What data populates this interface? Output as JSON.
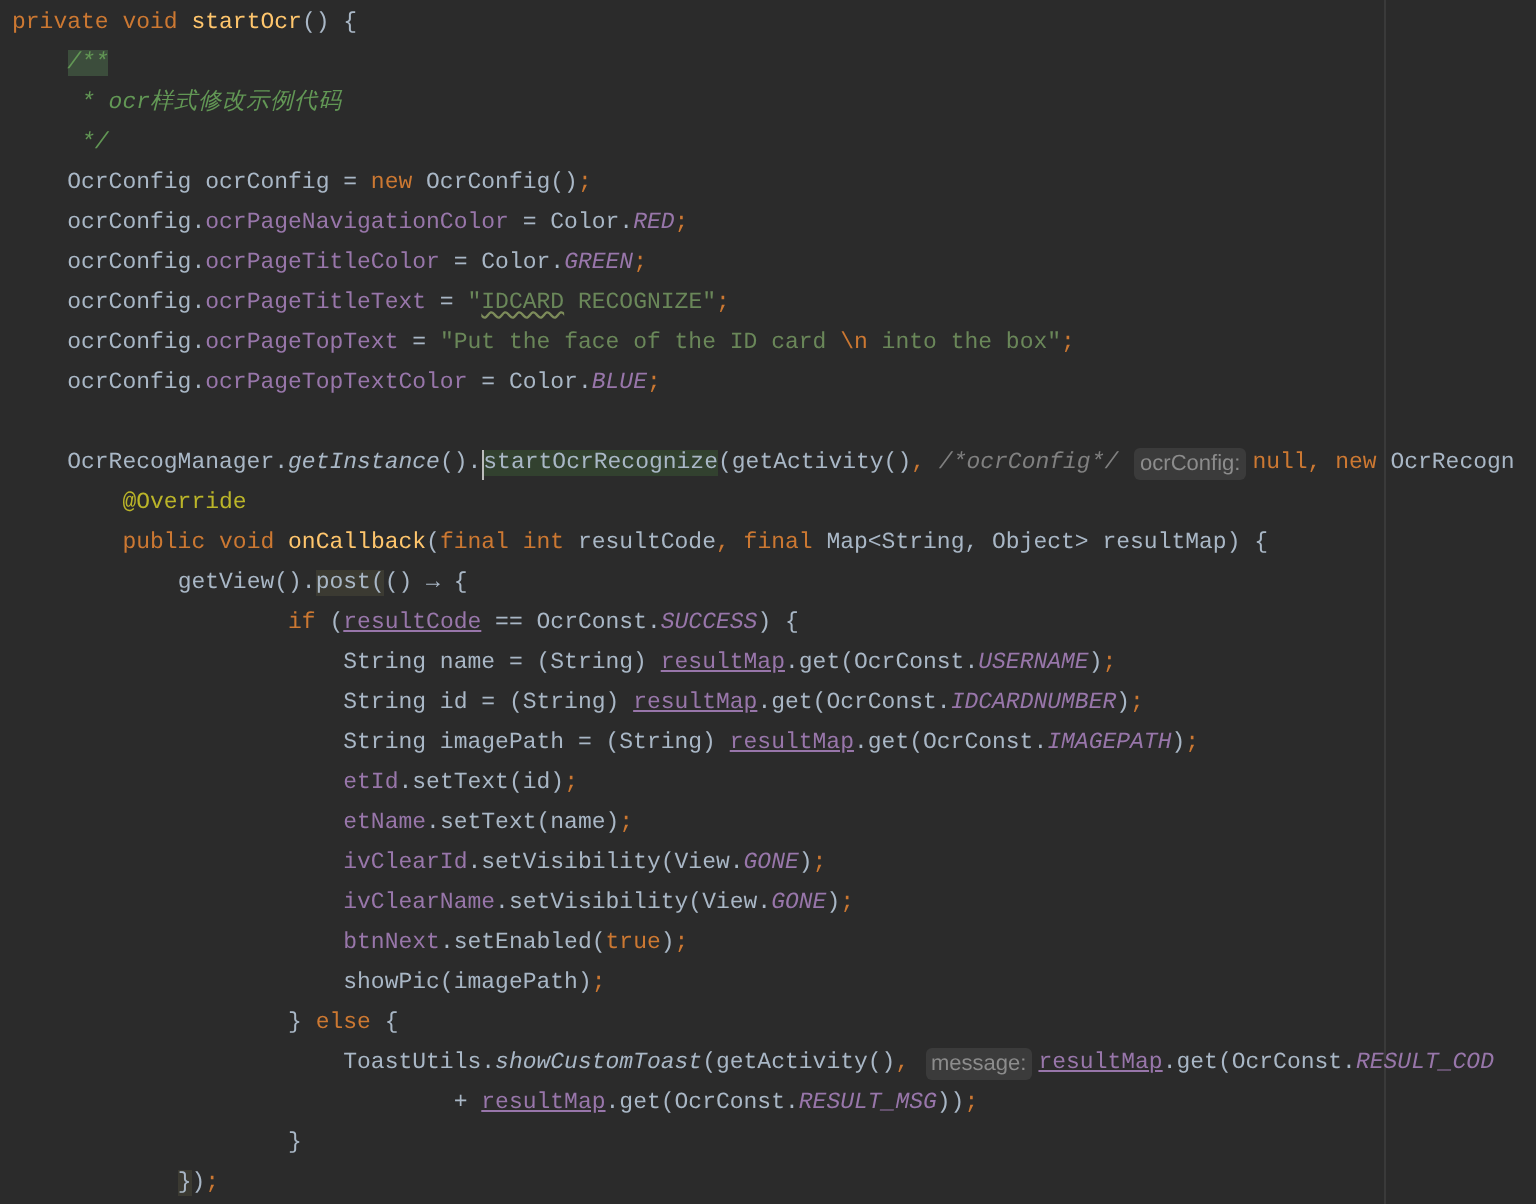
{
  "editor": {
    "lines": [
      {
        "tokens": [
          {
            "kind": "keyword",
            "text": "private void "
          },
          {
            "kind": "declaration",
            "text": "startOcr"
          },
          {
            "kind": "plain",
            "text": "() {"
          }
        ],
        "children": [
          {
            "tokens": [
              {
                "kind": "docmark",
                "text": "/**"
              }
            ]
          },
          {
            "tokens": [
              {
                "kind": "doc",
                "text": " * ocr样式修改示例代码"
              }
            ]
          },
          {
            "tokens": [
              {
                "kind": "doc",
                "text": " */"
              }
            ]
          },
          {
            "tokens": [
              {
                "kind": "plain",
                "text": "OcrConfig ocrConfig = "
              },
              {
                "kind": "keyword",
                "text": "new "
              },
              {
                "kind": "plain",
                "text": "OcrConfig()"
              },
              {
                "kind": "keyword",
                "text": ";"
              }
            ]
          },
          {
            "tokens": [
              {
                "kind": "plain",
                "text": "ocrConfig."
              },
              {
                "kind": "field",
                "text": "ocrPageNavigationColor"
              },
              {
                "kind": "plain",
                "text": " = Color."
              },
              {
                "kind": "static",
                "text": "RED"
              },
              {
                "kind": "keyword",
                "text": ";"
              }
            ]
          },
          {
            "tokens": [
              {
                "kind": "plain",
                "text": "ocrConfig."
              },
              {
                "kind": "field",
                "text": "ocrPageTitleColor"
              },
              {
                "kind": "plain",
                "text": " = Color."
              },
              {
                "kind": "static",
                "text": "GREEN"
              },
              {
                "kind": "keyword",
                "text": ";"
              }
            ]
          },
          {
            "tokens": [
              {
                "kind": "plain",
                "text": "ocrConfig."
              },
              {
                "kind": "field",
                "text": "ocrPageTitleText"
              },
              {
                "kind": "plain",
                "text": " = "
              },
              {
                "kind": "string",
                "text": "\""
              },
              {
                "kind": "typo",
                "text": "IDCARD"
              },
              {
                "kind": "string",
                "text": " RECOGNIZE\""
              },
              {
                "kind": "keyword",
                "text": ";"
              }
            ]
          },
          {
            "tokens": [
              {
                "kind": "plain",
                "text": "ocrConfig."
              },
              {
                "kind": "field",
                "text": "ocrPageTopText"
              },
              {
                "kind": "plain",
                "text": " = "
              },
              {
                "kind": "string",
                "text": "\"Put the face of the ID card "
              },
              {
                "kind": "keyword",
                "text": "\\n"
              },
              {
                "kind": "string",
                "text": " into the box\""
              },
              {
                "kind": "keyword",
                "text": ";"
              }
            ]
          },
          {
            "tokens": [
              {
                "kind": "plain",
                "text": "ocrConfig."
              },
              {
                "kind": "field",
                "text": "ocrPageTopTextColor"
              },
              {
                "kind": "plain",
                "text": " = Color."
              },
              {
                "kind": "static",
                "text": "BLUE"
              },
              {
                "kind": "keyword",
                "text": ";"
              }
            ]
          },
          {
            "blank": true
          },
          {
            "tokens": [
              {
                "kind": "plain",
                "text": "OcrRecogManager."
              },
              {
                "kind": "call",
                "text": "getInstance"
              },
              {
                "kind": "plain",
                "text": "()."
              },
              {
                "kind": "caret"
              },
              {
                "kind": "usage",
                "text": "startOcrRecognize"
              },
              {
                "kind": "plain",
                "text": "(getActivity()"
              },
              {
                "kind": "keyword",
                "text": ", "
              },
              {
                "kind": "comment",
                "text": "/*ocrConfig*/ "
              },
              {
                "kind": "hint",
                "text": "ocrConfig:"
              },
              {
                "kind": "keyword",
                "text": "null, new "
              },
              {
                "kind": "plain",
                "text": "OcrRecogn"
              }
            ],
            "children": [
              {
                "tokens": [
                  {
                    "kind": "annotation",
                    "text": "@Override"
                  }
                ]
              },
              {
                "tokens": [
                  {
                    "kind": "keyword",
                    "text": "public void "
                  },
                  {
                    "kind": "declaration",
                    "text": "onCallback"
                  },
                  {
                    "kind": "plain",
                    "text": "("
                  },
                  {
                    "kind": "keyword",
                    "text": "final int "
                  },
                  {
                    "kind": "plain",
                    "text": "resultCode"
                  },
                  {
                    "kind": "keyword",
                    "text": ", final "
                  },
                  {
                    "kind": "plain",
                    "text": "Map<String, Object> resultMap) {"
                  }
                ],
                "children": [
                  {
                    "tokens": [
                      {
                        "kind": "plain",
                        "text": "getView()."
                      },
                      {
                        "kind": "brace",
                        "text": "post("
                      },
                      {
                        "kind": "plain",
                        "text": "() → {"
                      }
                    ],
                    "children": [
                      {
                        "children": [
                          {
                            "tokens": [
                              {
                                "kind": "keyword",
                                "text": "if "
                              },
                              {
                                "kind": "plain",
                                "text": "("
                              },
                              {
                                "kind": "captured",
                                "text": "resultCode"
                              },
                              {
                                "kind": "plain",
                                "text": " == OcrConst."
                              },
                              {
                                "kind": "static",
                                "text": "SUCCESS"
                              },
                              {
                                "kind": "plain",
                                "text": ") {"
                              }
                            ],
                            "children": [
                              {
                                "tokens": [
                                  {
                                    "kind": "plain",
                                    "text": "String name = (String) "
                                  },
                                  {
                                    "kind": "captured",
                                    "text": "resultMap"
                                  },
                                  {
                                    "kind": "plain",
                                    "text": ".get(OcrConst."
                                  },
                                  {
                                    "kind": "static",
                                    "text": "USERNAME"
                                  },
                                  {
                                    "kind": "plain",
                                    "text": ")"
                                  },
                                  {
                                    "kind": "keyword",
                                    "text": ";"
                                  }
                                ]
                              },
                              {
                                "tokens": [
                                  {
                                    "kind": "plain",
                                    "text": "String id = (String) "
                                  },
                                  {
                                    "kind": "captured",
                                    "text": "resultMap"
                                  },
                                  {
                                    "kind": "plain",
                                    "text": ".get(OcrConst."
                                  },
                                  {
                                    "kind": "static",
                                    "text": "IDCARDNUMBER"
                                  },
                                  {
                                    "kind": "plain",
                                    "text": ")"
                                  },
                                  {
                                    "kind": "keyword",
                                    "text": ";"
                                  }
                                ]
                              },
                              {
                                "tokens": [
                                  {
                                    "kind": "plain",
                                    "text": "String imagePath = (String) "
                                  },
                                  {
                                    "kind": "captured",
                                    "text": "resultMap"
                                  },
                                  {
                                    "kind": "plain",
                                    "text": ".get(OcrConst."
                                  },
                                  {
                                    "kind": "static",
                                    "text": "IMAGEPATH"
                                  },
                                  {
                                    "kind": "plain",
                                    "text": ")"
                                  },
                                  {
                                    "kind": "keyword",
                                    "text": ";"
                                  }
                                ]
                              },
                              {
                                "tokens": [
                                  {
                                    "kind": "field",
                                    "text": "etId"
                                  },
                                  {
                                    "kind": "plain",
                                    "text": ".setText(id)"
                                  },
                                  {
                                    "kind": "keyword",
                                    "text": ";"
                                  }
                                ]
                              },
                              {
                                "tokens": [
                                  {
                                    "kind": "field",
                                    "text": "etName"
                                  },
                                  {
                                    "kind": "plain",
                                    "text": ".setText(name)"
                                  },
                                  {
                                    "kind": "keyword",
                                    "text": ";"
                                  }
                                ]
                              },
                              {
                                "tokens": [
                                  {
                                    "kind": "field",
                                    "text": "ivClearId"
                                  },
                                  {
                                    "kind": "plain",
                                    "text": ".setVisibility(View."
                                  },
                                  {
                                    "kind": "static",
                                    "text": "GONE"
                                  },
                                  {
                                    "kind": "plain",
                                    "text": ")"
                                  },
                                  {
                                    "kind": "keyword",
                                    "text": ";"
                                  }
                                ]
                              },
                              {
                                "tokens": [
                                  {
                                    "kind": "field",
                                    "text": "ivClearName"
                                  },
                                  {
                                    "kind": "plain",
                                    "text": ".setVisibility(View."
                                  },
                                  {
                                    "kind": "static",
                                    "text": "GONE"
                                  },
                                  {
                                    "kind": "plain",
                                    "text": ")"
                                  },
                                  {
                                    "kind": "keyword",
                                    "text": ";"
                                  }
                                ]
                              },
                              {
                                "tokens": [
                                  {
                                    "kind": "field",
                                    "text": "btnNext"
                                  },
                                  {
                                    "kind": "plain",
                                    "text": ".setEnabled("
                                  },
                                  {
                                    "kind": "keyword",
                                    "text": "true"
                                  },
                                  {
                                    "kind": "plain",
                                    "text": ")"
                                  },
                                  {
                                    "kind": "keyword",
                                    "text": ";"
                                  }
                                ]
                              },
                              {
                                "tokens": [
                                  {
                                    "kind": "plain",
                                    "text": "showPic(imagePath)"
                                  },
                                  {
                                    "kind": "keyword",
                                    "text": ";"
                                  }
                                ]
                              }
                            ]
                          },
                          {
                            "tokens": [
                              {
                                "kind": "plain",
                                "text": "} "
                              },
                              {
                                "kind": "keyword",
                                "text": "else "
                              },
                              {
                                "kind": "plain",
                                "text": "{"
                              }
                            ],
                            "children": [
                              {
                                "tokens": [
                                  {
                                    "kind": "plain",
                                    "text": "ToastUtils."
                                  },
                                  {
                                    "kind": "call",
                                    "text": "showCustomToast"
                                  },
                                  {
                                    "kind": "plain",
                                    "text": "(getActivity()"
                                  },
                                  {
                                    "kind": "keyword",
                                    "text": ", "
                                  },
                                  {
                                    "kind": "hint",
                                    "text": "message:"
                                  },
                                  {
                                    "kind": "captured",
                                    "text": "resultMap"
                                  },
                                  {
                                    "kind": "plain",
                                    "text": ".get(OcrConst."
                                  },
                                  {
                                    "kind": "static",
                                    "text": "RESULT_COD"
                                  }
                                ],
                                "children": [
                                  {
                                    "children": [
                                      {
                                        "tokens": [
                                          {
                                            "kind": "plain",
                                            "text": "+ "
                                          },
                                          {
                                            "kind": "captured",
                                            "text": "resultMap"
                                          },
                                          {
                                            "kind": "plain",
                                            "text": ".get(OcrConst."
                                          },
                                          {
                                            "kind": "static",
                                            "text": "RESULT_MSG"
                                          },
                                          {
                                            "kind": "plain",
                                            "text": "))"
                                          },
                                          {
                                            "kind": "keyword",
                                            "text": ";"
                                          }
                                        ]
                                      }
                                    ]
                                  }
                                ]
                              }
                            ]
                          },
                          {
                            "tokens": [
                              {
                                "kind": "plain",
                                "text": "}"
                              }
                            ]
                          }
                        ]
                      }
                    ]
                  },
                  {
                    "tokens": [
                      {
                        "kind": "brace",
                        "text": "}"
                      },
                      {
                        "kind": "plain",
                        "text": ")"
                      },
                      {
                        "kind": "keyword",
                        "text": ";"
                      }
                    ]
                  }
                ]
              }
            ]
          }
        ]
      }
    ]
  }
}
